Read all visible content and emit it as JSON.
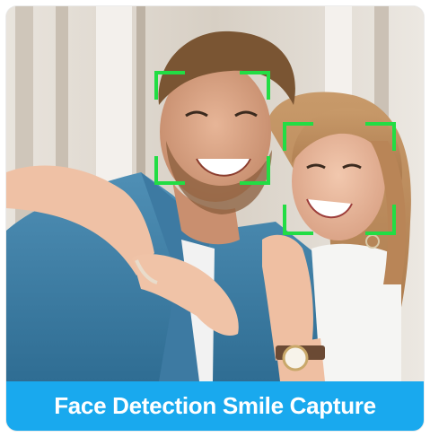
{
  "caption": {
    "text": "Face Detection Smile Capture"
  },
  "colors": {
    "caption_background": "#19a9ee",
    "caption_text": "#ffffff",
    "detection_frame": "#22dd44"
  },
  "detections": [
    {
      "label": "man-face"
    },
    {
      "label": "woman-face"
    }
  ]
}
